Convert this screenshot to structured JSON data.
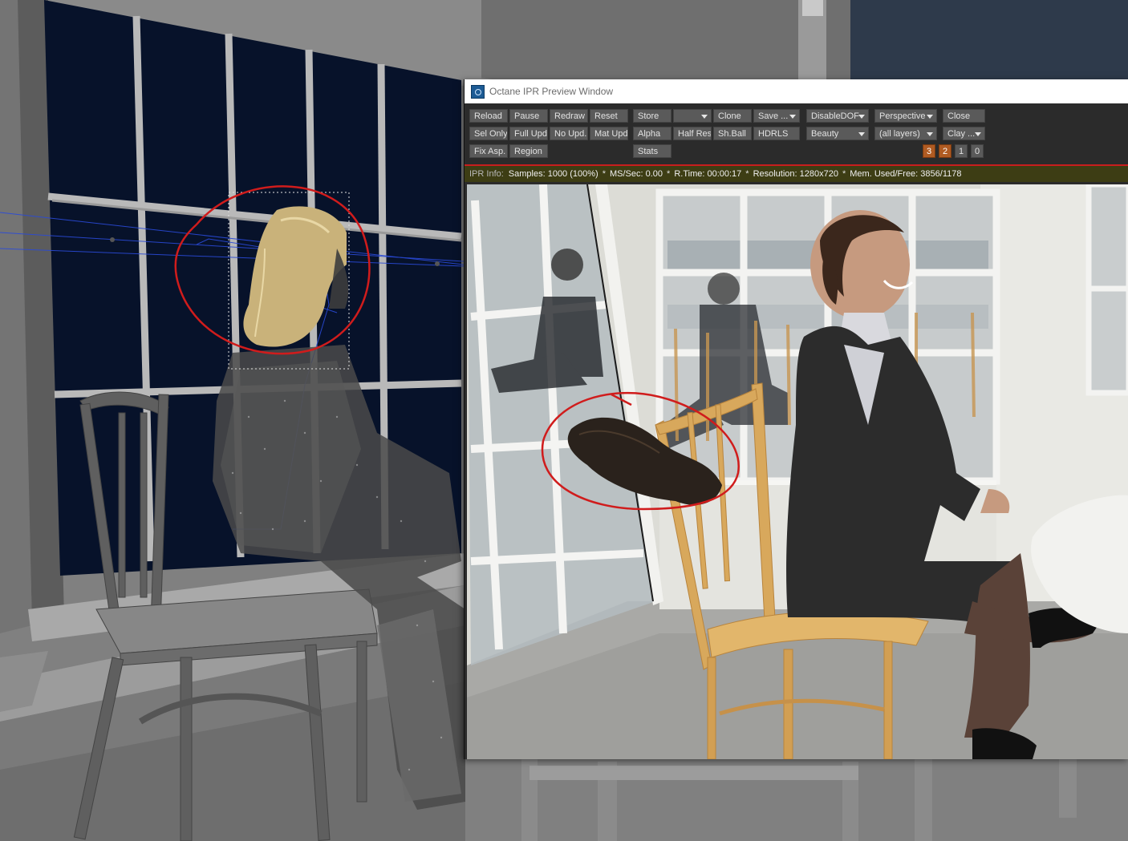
{
  "window": {
    "title": "Octane IPR Preview Window",
    "icon": "octane-app-icon"
  },
  "toolbar": {
    "row1": {
      "reload": "Reload",
      "pause": "Pause",
      "redraw": "Redraw",
      "reset": "Reset",
      "store": "Store",
      "store_slot": "",
      "clone": "Clone",
      "save": "Save ...",
      "dof": "DisableDOF",
      "camera": "Perspective",
      "close": "Close"
    },
    "row2": {
      "sel_only": "Sel Only",
      "full_upd": "Full Upd.",
      "no_upd": "No Upd.",
      "mat_upd": "Mat Upd",
      "alpha": "Alpha",
      "half_res": "Half Res",
      "sh_ball": "Sh.Ball",
      "hdrls": "HDRLS",
      "pass": "Beauty",
      "layers": "(all layers)",
      "kernel": "Clay ..."
    },
    "row3": {
      "fix_asp": "Fix Asp.",
      "region": "Region",
      "stats": "Stats",
      "gpu_buttons": [
        "3",
        "2",
        "1",
        "0"
      ]
    }
  },
  "info": {
    "label": "IPR Info:",
    "samples": "Samples: 1000 (100%)",
    "ms_sec": "MS/Sec: 0.00",
    "r_time": "R.Time: 00:00:17",
    "resolution": "Resolution: 1280x720",
    "mem": "Mem. Used/Free: 3856/1178",
    "separator": "*"
  },
  "colors": {
    "toolbar_bg": "#2b2b2b",
    "button_bg": "#5a5a5a",
    "gpu_active": "#b05b22",
    "info_bg": "#3d3d14",
    "annotation_red": "#d01c1c",
    "viewport_window": "#0a1530"
  }
}
